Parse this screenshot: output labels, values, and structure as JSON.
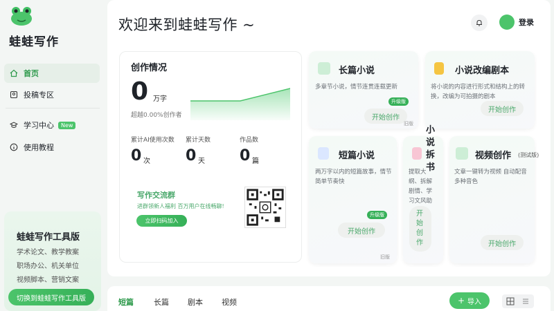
{
  "app": {
    "brand": "蛙蛙写作"
  },
  "sidebar": {
    "items": [
      {
        "label": "首页",
        "icon": "home-icon",
        "active": true
      },
      {
        "label": "投稿专区",
        "icon": "contribute-icon",
        "active": false
      },
      {
        "label": "学习中心",
        "icon": "graduation-cap-icon",
        "badge": "New",
        "active": false
      },
      {
        "label": "使用教程",
        "icon": "info-icon",
        "active": false
      }
    ],
    "promo": {
      "title": "蛙蛙写作工具版",
      "lines": [
        "学术论文、教学教案",
        "职场办公、机关单位",
        "视频脚本、营销文案"
      ],
      "button": "切换到蛙蛙写作工具版"
    }
  },
  "header": {
    "welcome": "欢迎来到蛙蛙写作 ~",
    "login": "登录"
  },
  "stats": {
    "title": "创作情况",
    "words": "0",
    "words_unit": "万字",
    "beat": "超越0.00%创作者",
    "items": [
      {
        "label": "累计AI使用次数",
        "value": "0",
        "unit": "次"
      },
      {
        "label": "累计天数",
        "value": "0",
        "unit": "天"
      },
      {
        "label": "作品数",
        "value": "0",
        "unit": "篇"
      }
    ],
    "group": {
      "title": "写作交流群",
      "subtitle": "进群领新人福利 百万用户在线畅聊!",
      "button": "立即扫码加入"
    }
  },
  "features": {
    "long_novel": {
      "title": "长篇小说",
      "desc": "多章节小说，情节连贯连载更新",
      "button": "开始创作",
      "upgrade": "升级版",
      "tag": "旧版"
    },
    "adapt": {
      "title": "小说改编剧本",
      "desc": "将小说的内容进行形式和结构上的转换，改编为可拍摄的剧本",
      "button": "开始创作"
    },
    "short_novel": {
      "title": "短篇小说",
      "desc": "两万字以内的短篇故事，情节简单节奏快",
      "button": "开始创作",
      "upgrade": "升级版",
      "tag": "旧版"
    },
    "split": {
      "title": "小说拆书",
      "desc": "提取大纲、拆解剧情、学习文风助力创作",
      "button": "开始创作"
    },
    "video": {
      "title": "视频创作",
      "title_note": "(测试版)",
      "desc": "文章一键转为视频 自动配音 多种音色",
      "button": "开始创作"
    }
  },
  "bottom": {
    "tabs": [
      {
        "label": "短篇",
        "active": true
      },
      {
        "label": "长篇",
        "active": false
      },
      {
        "label": "剧本",
        "active": false
      },
      {
        "label": "视频",
        "active": false
      }
    ],
    "import": "导入"
  },
  "colors": {
    "accent": "#4cc46b",
    "accent_dark": "#2e9a4c"
  }
}
